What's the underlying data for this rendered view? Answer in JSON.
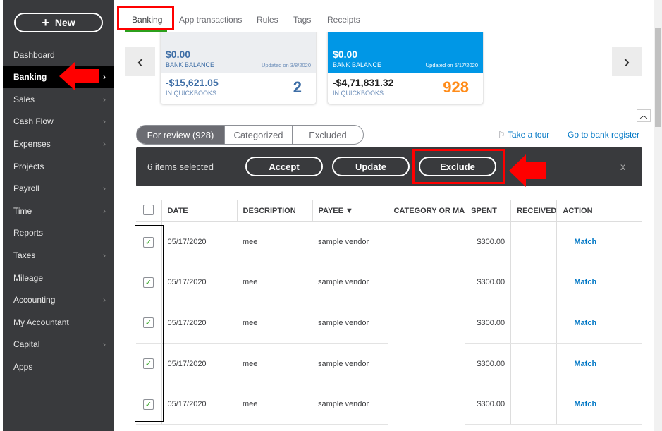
{
  "sidebar": {
    "new_label": "New",
    "items": [
      {
        "label": "Dashboard",
        "chev": false
      },
      {
        "label": "Banking",
        "chev": true,
        "active": true
      },
      {
        "label": "Sales",
        "chev": true
      },
      {
        "label": "Cash Flow",
        "chev": true
      },
      {
        "label": "Expenses",
        "chev": true
      },
      {
        "label": "Projects",
        "chev": false
      },
      {
        "label": "Payroll",
        "chev": true
      },
      {
        "label": "Time",
        "chev": true
      },
      {
        "label": "Reports",
        "chev": false
      },
      {
        "label": "Taxes",
        "chev": true
      },
      {
        "label": "Mileage",
        "chev": false
      },
      {
        "label": "Accounting",
        "chev": true
      },
      {
        "label": "My Accountant",
        "chev": false
      },
      {
        "label": "Capital",
        "chev": true
      },
      {
        "label": "Apps",
        "chev": false
      }
    ]
  },
  "tabs": [
    "Banking",
    "App transactions",
    "Rules",
    "Tags",
    "Receipts"
  ],
  "cards": [
    {
      "bank_balance": "$0.00",
      "bank_balance_label": "BANK BALANCE",
      "updated": "Updated on 3/8/2020",
      "qb_amount": "-$15,621.05",
      "qb_label": "IN QUICKBOOKS",
      "count": "2"
    },
    {
      "bank_balance": "$0.00",
      "bank_balance_label": "BANK BALANCE",
      "updated": "Updated on 5/17/2020",
      "qb_amount": "-$4,71,831.32",
      "qb_label": "IN QUICKBOOKS",
      "count": "928"
    }
  ],
  "segments": [
    "For review (928)",
    "Categorized",
    "Excluded"
  ],
  "links": {
    "tour": "Take a tour",
    "register": "Go to bank register"
  },
  "batch": {
    "selected": "6 items selected",
    "accept": "Accept",
    "update": "Update",
    "exclude": "Exclude",
    "close": "x"
  },
  "table": {
    "headers": [
      "DATE",
      "DESCRIPTION",
      "PAYEE ▼",
      "CATEGORY OR MA",
      "SPENT",
      "RECEIVED",
      "ACTION"
    ],
    "rows": [
      {
        "date": "05/17/2020",
        "description": "mee",
        "payee": "sample vendor",
        "category": "",
        "spent": "$300.00",
        "received": "",
        "action": "Match"
      },
      {
        "date": "05/17/2020",
        "description": "mee",
        "payee": "sample vendor",
        "category": "",
        "spent": "$300.00",
        "received": "",
        "action": "Match"
      },
      {
        "date": "05/17/2020",
        "description": "mee",
        "payee": "sample vendor",
        "category": "",
        "spent": "$300.00",
        "received": "",
        "action": "Match"
      },
      {
        "date": "05/17/2020",
        "description": "mee",
        "payee": "sample vendor",
        "category": "",
        "spent": "$300.00",
        "received": "",
        "action": "Match"
      },
      {
        "date": "05/17/2020",
        "description": "mee",
        "payee": "sample vendor",
        "category": "",
        "spent": "$300.00",
        "received": "",
        "action": "Match"
      }
    ]
  },
  "colors": {
    "sidebar": "#393a3d",
    "accent": "#0077c5",
    "card_blue": "#0097e6",
    "orange": "#ff8c1a",
    "annotation_red": "#ff0000"
  }
}
